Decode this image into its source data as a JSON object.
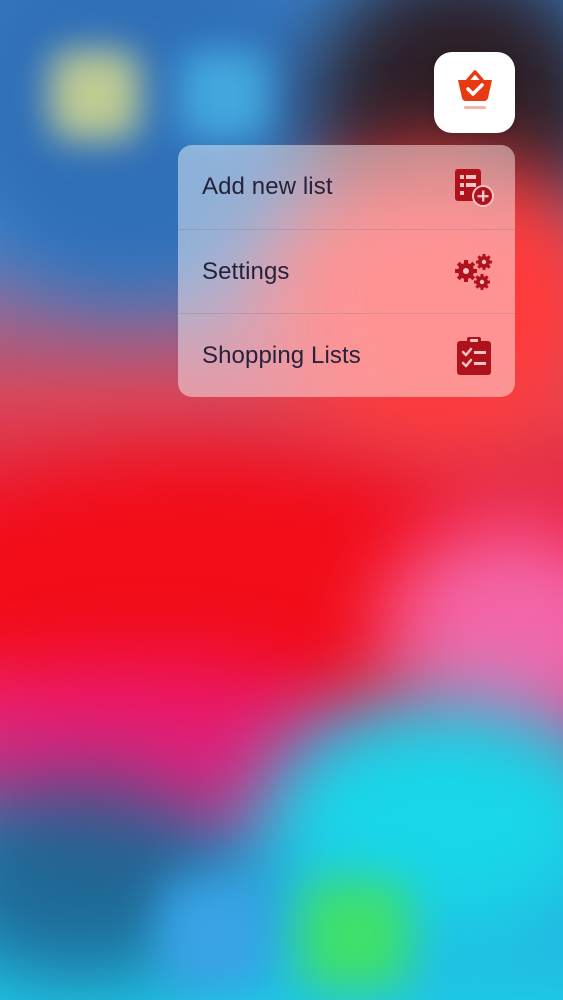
{
  "app": {
    "icon_name": "shopping-basket-icon",
    "accent_color": "#e63a12"
  },
  "quick_actions": [
    {
      "label": "Add new list",
      "icon": "add-list-icon"
    },
    {
      "label": "Settings",
      "icon": "gears-icon"
    },
    {
      "label": "Shopping Lists",
      "icon": "clipboard-check-icon"
    }
  ],
  "colors": {
    "icon_color": "#b0121c",
    "text_color": "#26223c"
  }
}
